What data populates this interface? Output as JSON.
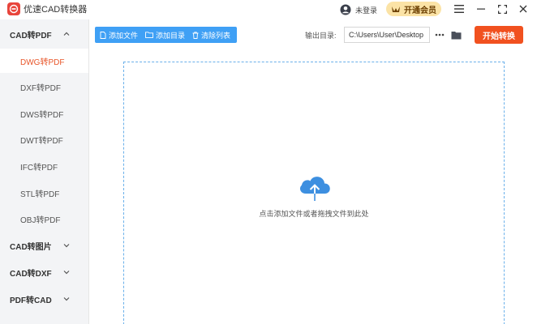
{
  "app": {
    "title": "优速CAD转换器",
    "user_label": "未登录",
    "vip_label": "开通会员"
  },
  "colors": {
    "accent_blue": "#3fa0f5",
    "accent_orange": "#f1511f",
    "active_text": "#e8562a",
    "vip_bg": "#fbe3a6"
  },
  "sidebar": {
    "groups": [
      {
        "label": "CAD转PDF",
        "expanded": true,
        "items": [
          {
            "label": "DWG转PDF",
            "active": true
          },
          {
            "label": "DXF转PDF",
            "active": false
          },
          {
            "label": "DWS转PDF",
            "active": false
          },
          {
            "label": "DWT转PDF",
            "active": false
          },
          {
            "label": "IFC转PDF",
            "active": false
          },
          {
            "label": "STL转PDF",
            "active": false
          },
          {
            "label": "OBJ转PDF",
            "active": false
          }
        ]
      },
      {
        "label": "CAD转图片",
        "expanded": false
      },
      {
        "label": "CAD转DXF",
        "expanded": false
      },
      {
        "label": "PDF转CAD",
        "expanded": false
      }
    ]
  },
  "toolbar": {
    "add_file": "添加文件",
    "add_folder": "添加目录",
    "clear_list": "清除列表",
    "output_label": "输出目录:",
    "output_path": "C:\\Users\\User\\Desktop",
    "start": "开始转换"
  },
  "dropzone": {
    "hint": "点击添加文件或者拖拽文件到此处"
  }
}
